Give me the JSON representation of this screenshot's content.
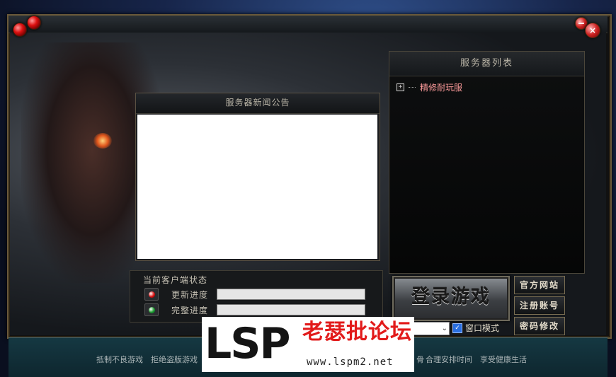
{
  "window": {
    "controls": {
      "minimize": "minimize",
      "close": "×"
    }
  },
  "news": {
    "title": "服务器新闻公告"
  },
  "server_list": {
    "title": "服务器列表",
    "items": [
      {
        "expand": "+",
        "name": "精修耐玩服"
      }
    ]
  },
  "status": {
    "title": "当前客户端状态",
    "update_label": "更新进度",
    "complete_label": "完整进度",
    "update_progress": 0.0,
    "complete_progress": 0.0
  },
  "actions": {
    "login": "登录游戏",
    "official_site": "官方网站",
    "register": "注册账号",
    "change_password": "密码修改",
    "window_mode": "窗口模式",
    "window_mode_checked": "✓",
    "select_chevron": "⌄"
  },
  "footer": {
    "left": "抵制不良游戏　拒绝盗版游戏",
    "right": "合理安排时间　享受健康生活",
    "right_prefix": "骨"
  },
  "watermark": {
    "logo": "LSP",
    "name": "老瑟批论坛",
    "url": "www.lspm2.net"
  },
  "colors": {
    "progress_fill": "#06107a",
    "server_name": "#ff9c9c",
    "watermark_red": "#e21a1a"
  }
}
